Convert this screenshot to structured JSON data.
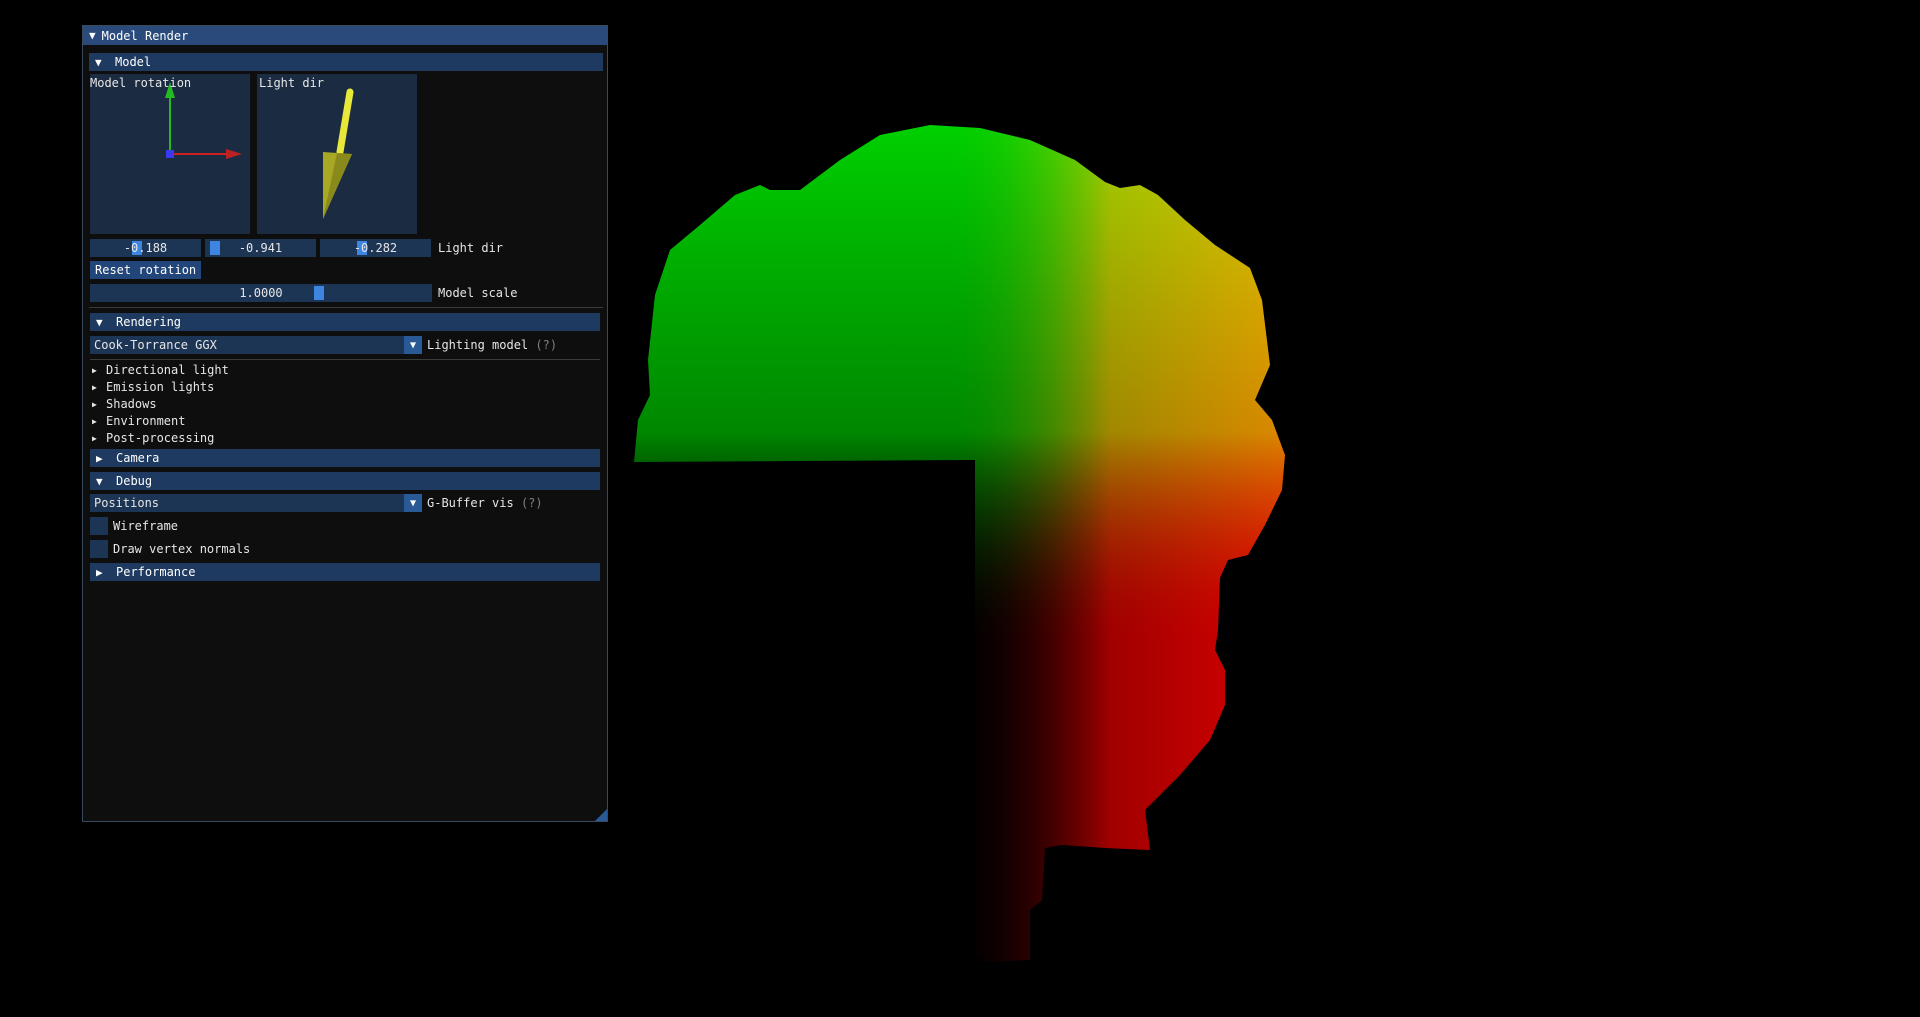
{
  "window": {
    "title": "Model Render"
  },
  "model": {
    "header": "Model",
    "rotation_label": "Model rotation",
    "light_dir_label": "Light dir",
    "light_dir_values": [
      "-0.188",
      "-0.941",
      "-0.282"
    ],
    "light_dir_row_label": "Light dir",
    "reset_label": "Reset rotation",
    "scale_value": "1.0000",
    "scale_label": "Model scale"
  },
  "rendering": {
    "header": "Rendering",
    "lighting_value": "Cook-Torrance GGX",
    "lighting_label": "Lighting model",
    "help": "(?)",
    "items": [
      "Directional light",
      "Emission lights",
      "Shadows",
      "Environment",
      "Post-processing"
    ]
  },
  "camera": {
    "header": "Camera"
  },
  "debug": {
    "header": "Debug",
    "gbuffer_value": "Positions",
    "gbuffer_label": "G-Buffer vis",
    "help": "(?)",
    "wireframe_label": "Wireframe",
    "normals_label": "Draw vertex normals"
  },
  "performance": {
    "header": "Performance"
  },
  "colors": {
    "title_bar": "#294a7a",
    "header": "#1e3a60",
    "frame": "#1d3554",
    "accent": "#3d85e0"
  }
}
